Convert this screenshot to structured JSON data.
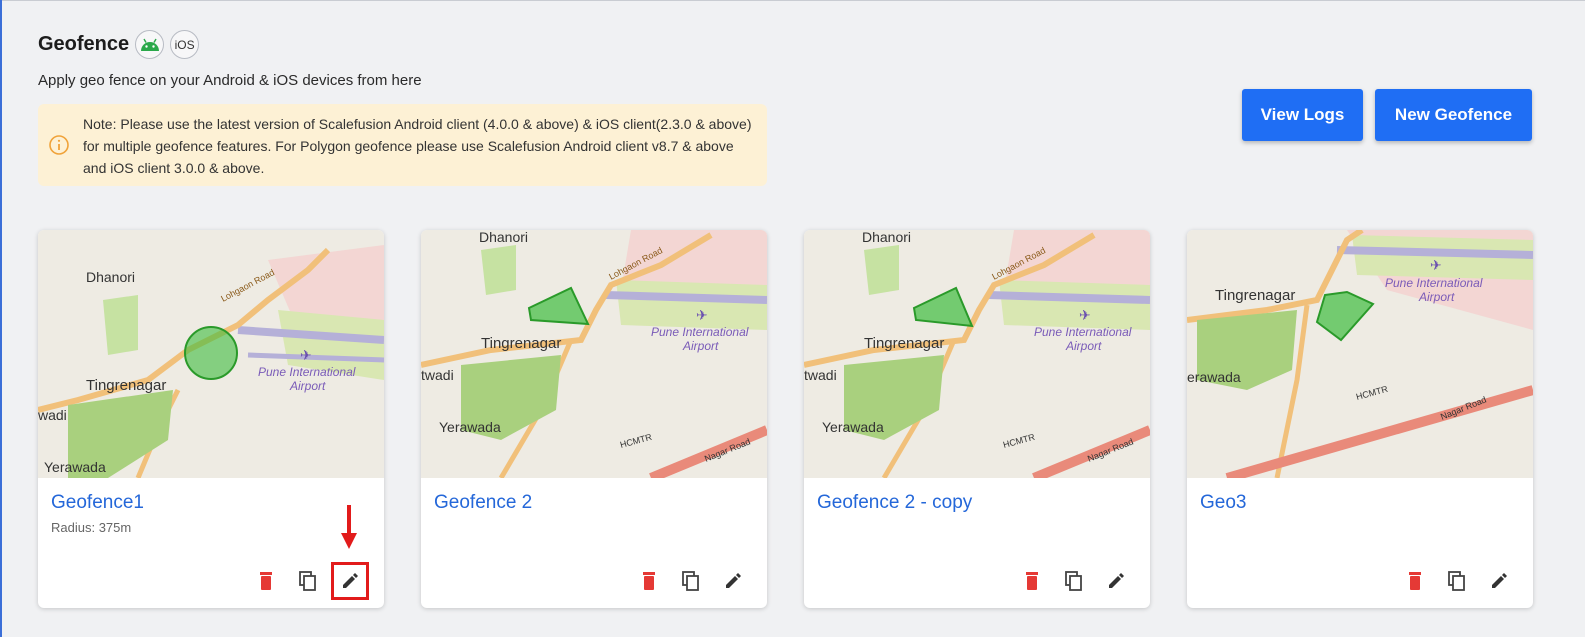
{
  "header": {
    "title": "Geofence",
    "ios_badge": "iOS",
    "subtitle": "Apply geo fence on your Android & iOS devices from here"
  },
  "note": {
    "text": "Note: Please use the latest version of Scalefusion Android client (4.0.0 & above) & iOS client(2.3.0 & above) for multiple geofence features. For Polygon geofence please use Scalefusion Android client v8.7 & above and iOS client 3.0.0 & above."
  },
  "buttons": {
    "view_logs": "View Logs",
    "new_geofence": "New Geofence"
  },
  "map_labels": {
    "dhanori": "Dhanori",
    "tingrenagar": "Tingrenagar",
    "yerawada": "Yerawada",
    "wadi": "wadi",
    "twadi": "twadi",
    "erawada": "erawada",
    "lohgaon": "Lohgaon Road",
    "airport1": "Pune International",
    "airport2": "Airport",
    "hcmtr": "HCMTR",
    "nagar": "Nagar Road"
  },
  "cards": [
    {
      "name": "Geofence1",
      "detail": "Radius: 375m"
    },
    {
      "name": "Geofence 2",
      "detail": ""
    },
    {
      "name": "Geofence 2 - copy",
      "detail": ""
    },
    {
      "name": "Geo3",
      "detail": ""
    }
  ],
  "colors": {
    "accent": "#1f6ef4",
    "link": "#2467d9",
    "delete": "#e53935",
    "note_bg": "#fdf1d5",
    "fence": "#2fb52f",
    "highlight": "#e21b1b"
  },
  "icons": [
    "android-icon",
    "info-icon",
    "delete-icon",
    "copy-icon",
    "edit-icon"
  ]
}
